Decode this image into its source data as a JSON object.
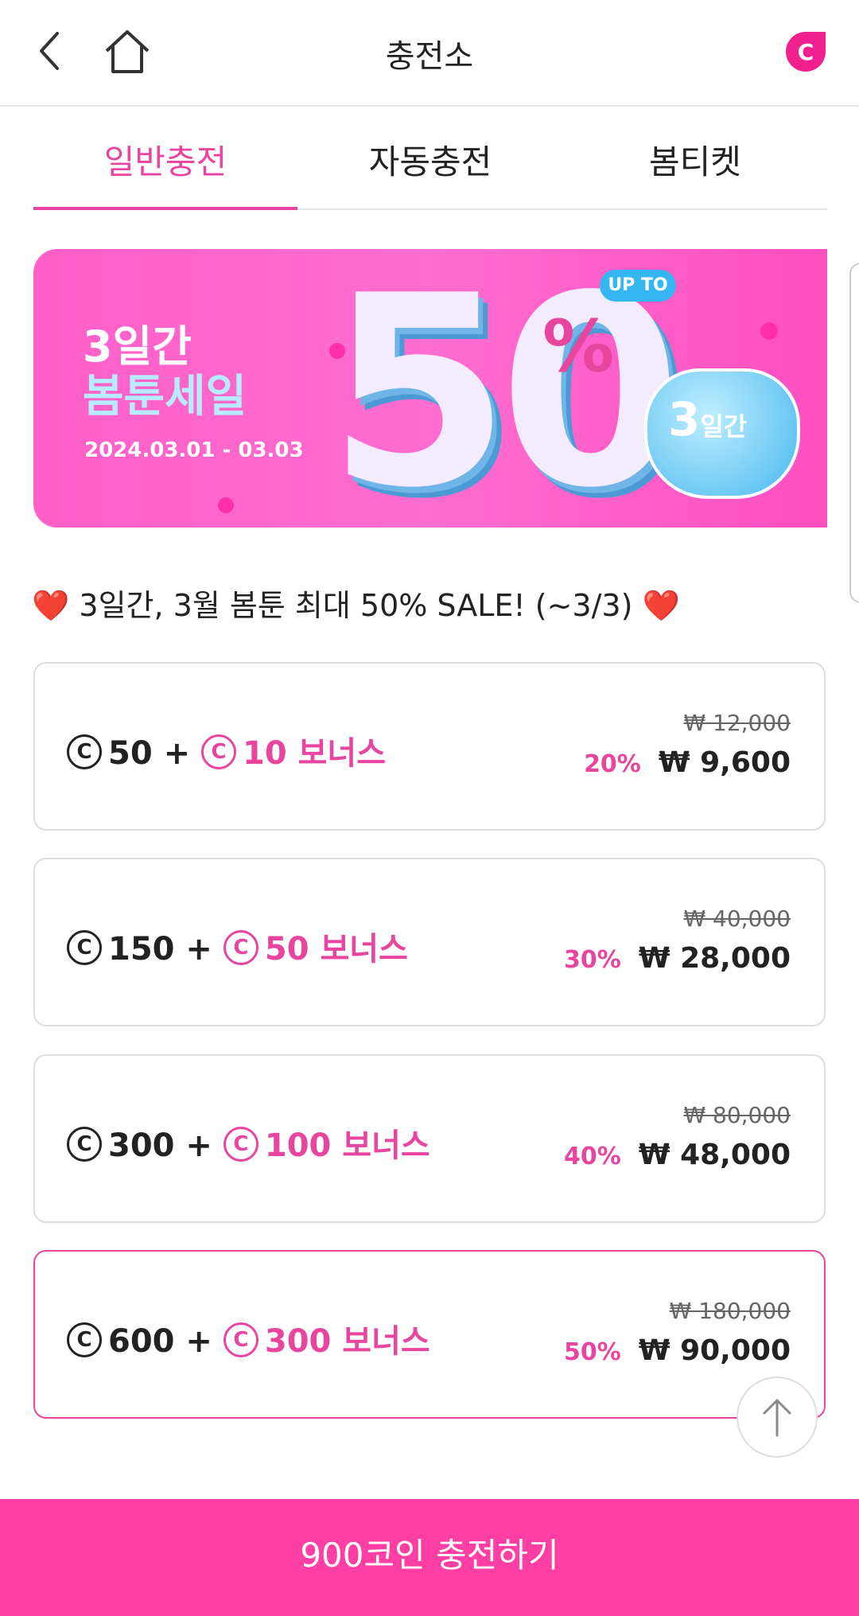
{
  "header": {
    "title": "충전소",
    "back_icon": "chevron-left-icon",
    "home_icon": "home-icon",
    "logo_letter": "C"
  },
  "tabs": [
    {
      "label": "일반충전",
      "active": true
    },
    {
      "label": "자동충전",
      "active": false
    },
    {
      "label": "봄티켓",
      "active": false
    }
  ],
  "banner": {
    "line1": "3일간",
    "line2": "봄툰세일",
    "date": "2024.03.01 - 03.03",
    "big_number": "50",
    "percent": "%",
    "up_to": "UP TO",
    "badge_number": "3",
    "badge_text": "일간"
  },
  "promo": {
    "text": "3일간, 3월 봄툰 최대 50% SALE! (~3/3)",
    "emoji": "❤️"
  },
  "coin_symbol": "C",
  "packages": [
    {
      "coins": "50 +",
      "bonus": "10 보너스",
      "original": "₩ 12,000",
      "discount": "20%",
      "price": "₩ 9,600",
      "selected": false
    },
    {
      "coins": "150 +",
      "bonus": "50 보너스",
      "original": "₩ 40,000",
      "discount": "30%",
      "price": "₩ 28,000",
      "selected": false
    },
    {
      "coins": "300 +",
      "bonus": "100 보너스",
      "original": "₩ 80,000",
      "discount": "40%",
      "price": "₩ 48,000",
      "selected": false
    },
    {
      "coins": "600 +",
      "bonus": "300 보너스",
      "original": "₩ 180,000",
      "discount": "50%",
      "price": "₩ 90,000",
      "selected": true
    }
  ],
  "scroll_top_icon": "arrow-up-icon",
  "charge_button": "900코인 충전하기",
  "colors": {
    "accent": "#e8459f",
    "button": "#ff3fa4"
  }
}
